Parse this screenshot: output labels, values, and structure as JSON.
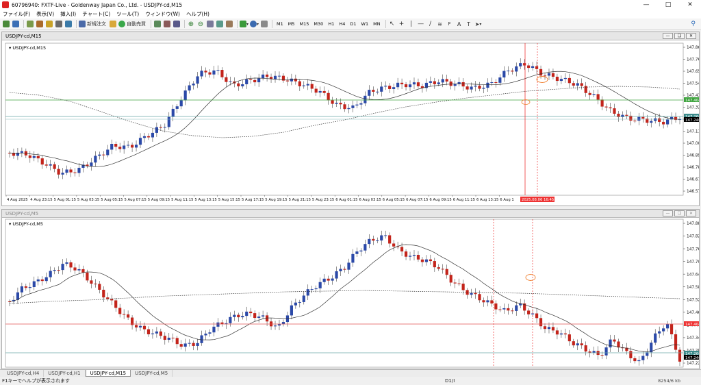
{
  "window": {
    "title": "60796940: FXTF-Live - Goldenway Japan Co., Ltd. - USDJPY-cd,M15"
  },
  "menu": [
    "ファイル(F)",
    "表示(V)",
    "挿入(I)",
    "チャート(C)",
    "ツール(T)",
    "ウィンドウ(W)",
    "ヘルプ(H)"
  ],
  "toolbar": {
    "new_order": "新規注文",
    "auto_trade": "自動売買",
    "timeframes": [
      "M1",
      "M5",
      "M15",
      "M30",
      "H1",
      "H4",
      "D1",
      "W1",
      "MN"
    ]
  },
  "colors": {
    "bull": "#2b49a8",
    "bear": "#c3241b",
    "green_line": "#3da33d",
    "red_line": "#e05050",
    "teal_line": "#6aa8a8"
  },
  "chart_top": {
    "window_title": "USDJPY-cd,M15",
    "label": "USDJPY-cd,M15",
    "y_ticks": [
      "147.865",
      "147.760",
      "147.650",
      "147.540",
      "147.430",
      "147.325",
      "147.215",
      "147.110",
      "147.000",
      "146.895",
      "146.785",
      "146.675",
      "146.570"
    ],
    "price_green": "147.404",
    "price_teal_1": "147.264",
    "price_teal_2": "147.246",
    "x_labels": [
      "4 Aug 2025",
      "4 Aug 23:15",
      "5 Aug 01:15",
      "5 Aug 03:15",
      "5 Aug 05:15",
      "5 Aug 07:15",
      "5 Aug 09:15",
      "5 Aug 11:15",
      "5 Aug 13:15",
      "5 Aug 15:15",
      "5 Aug 17:15",
      "5 Aug 19:15",
      "5 Aug 21:15",
      "5 Aug 23:15",
      "6 Aug 01:15",
      "6 Aug 03:15",
      "6 Aug 05:15",
      "6 Aug 07:15",
      "6 Aug 09:15",
      "6 Aug 11:15",
      "6 Aug 13:15",
      "6 Aug 1"
    ],
    "cursor_label": "2025.08.06 16:45"
  },
  "chart_bottom": {
    "window_title": "USDJPY-cd,M5",
    "label": "USDJPY-cd,M5",
    "y_ticks": [
      "147.885",
      "147.825",
      "147.765",
      "147.705",
      "147.645",
      "147.585",
      "147.525",
      "147.465",
      "147.405",
      "147.345",
      "147.285",
      "147.225"
    ],
    "price_red": "147.404",
    "price_teal_1": "147.266",
    "price_teal_2": "147.246"
  },
  "tabs": [
    "USDJPY-cd,H4",
    "USDJPY-cd,H1",
    "USDJPY-cd,M15",
    "USDJPY-cd,M5"
  ],
  "active_tab": 2,
  "status": {
    "left": "F1キーでヘルプが表示されます",
    "middle": "D1/I",
    "right": "8254/6 kb"
  }
}
